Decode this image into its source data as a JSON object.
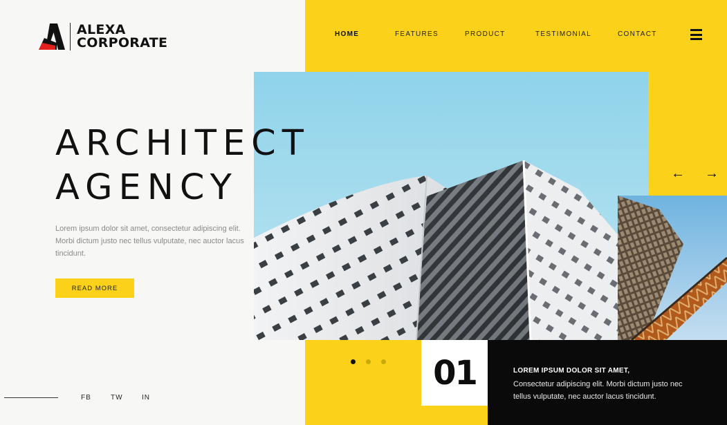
{
  "brand": {
    "line1": "ALEXA",
    "line2": "CORPORATE"
  },
  "nav": {
    "items": [
      {
        "label": "HOME",
        "active": true
      },
      {
        "label": "FEATURES",
        "active": false
      },
      {
        "label": "PRODUCT",
        "active": false
      },
      {
        "label": "TESTIMONIAL",
        "active": false
      },
      {
        "label": "CONTACT",
        "active": false
      }
    ],
    "menu_icon": "hamburger-menu-icon"
  },
  "hero": {
    "title_line1": "ARCHITECT",
    "title_line2": "AGENCY",
    "description": "Lorem ipsum dolor sit amet, consectetur adipiscing elit. Morbi dictum justo nec tellus vulputate, nec auctor lacus tincidunt.",
    "cta_label": "READ MORE"
  },
  "slider": {
    "prev_icon": "arrow-left-icon",
    "next_icon": "arrow-right-icon",
    "prev_glyph": "←",
    "next_glyph": "→",
    "total_dots": 3,
    "active_dot": 1,
    "number": "01",
    "info_title": "LOREM IPSUM DOLOR SIT AMET,",
    "info_text": "Consectetur adipiscing elit. Morbi dictum justo nec tellus vulputate, nec auctor lacus tincidunt."
  },
  "social": [
    {
      "label": "FB"
    },
    {
      "label": "TW"
    },
    {
      "label": "IN"
    }
  ],
  "colors": {
    "accent": "#fbd11a",
    "dark": "#0a0a0a",
    "background": "#f7f7f5",
    "logo_red": "#e2211c"
  }
}
